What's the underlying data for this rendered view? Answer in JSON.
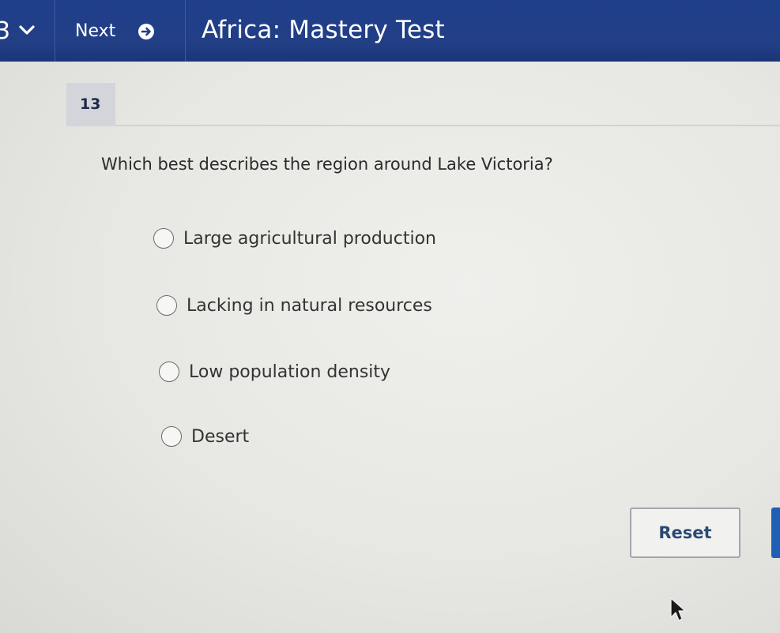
{
  "topbar": {
    "question_number_partial": "3",
    "next_label": "Next",
    "title": "Africa: Mastery Test"
  },
  "question": {
    "number": "13",
    "text": "Which best describes the region around Lake Victoria?",
    "options": [
      "Large agricultural production",
      "Lacking in natural resources",
      "Low population density",
      "Desert"
    ]
  },
  "actions": {
    "reset_label": "Reset"
  },
  "colors": {
    "topbar": "#223f86",
    "badge": "#d3d5db",
    "reset_text": "#2a4a74",
    "primary_button": "#1f5fb5"
  },
  "icons": {
    "menu": "chevron-down-icon",
    "next": "arrow-right-circle-icon",
    "pointer": "cursor-icon"
  }
}
